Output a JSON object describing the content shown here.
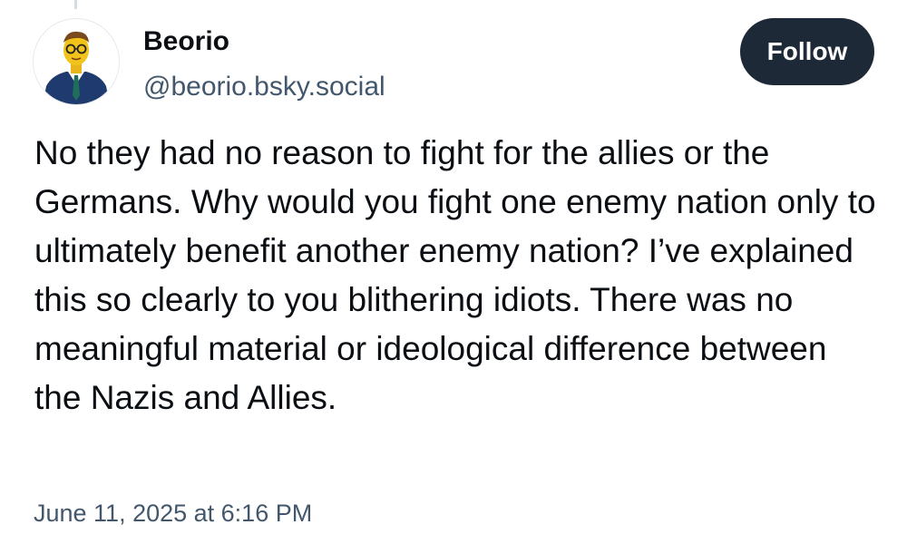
{
  "author": {
    "display_name": "Beorio",
    "handle": "@beorio.bsky.social",
    "avatar_icon": "avatar-yellow-face-suit-icon"
  },
  "actions": {
    "follow_label": "Follow"
  },
  "post": {
    "text": "No they had no reason to fight for the allies or the Germans. Why would you fight one enemy nation only to ultimately benefit another enemy nation? I’ve explained this so clearly to you blithering idiots. There was no meaningful material or ideological difference between the Nazis and Allies.",
    "timestamp": "June 11, 2025 at 6:16 PM"
  },
  "colors": {
    "text_primary": "#0b0f14",
    "text_secondary": "#42576c",
    "follow_button_bg": "#1e2937",
    "follow_button_text": "#ffffff",
    "background": "#ffffff"
  }
}
